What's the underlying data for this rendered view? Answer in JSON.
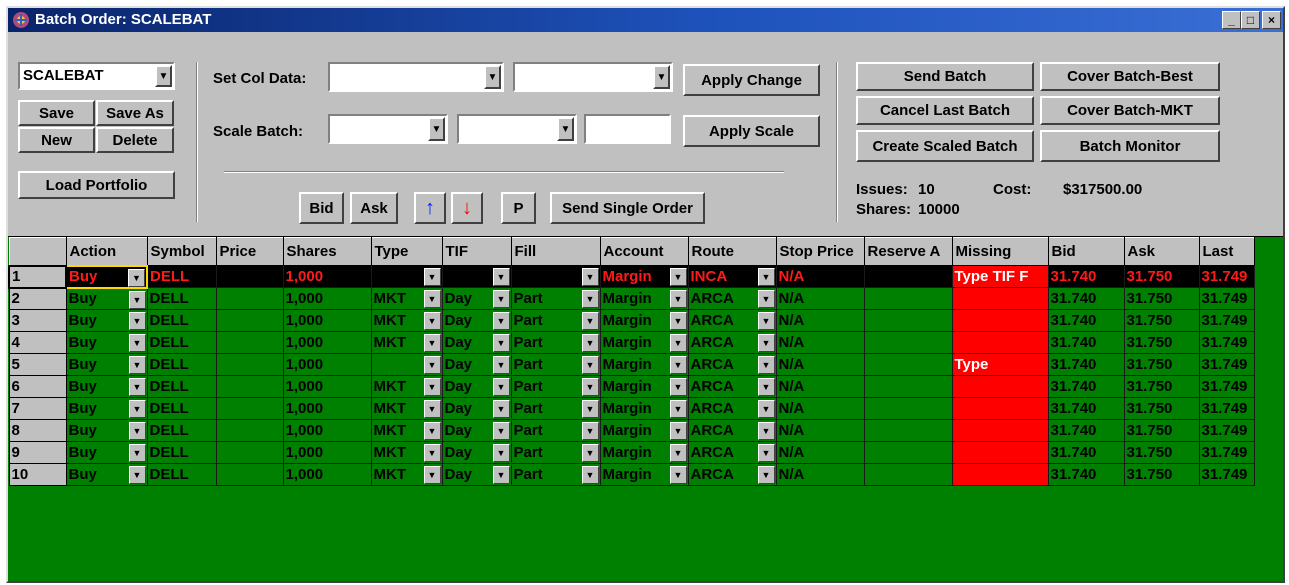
{
  "window": {
    "title": "Batch Order: SCALEBAT",
    "controls": {
      "minimize": "_",
      "maximize": "□",
      "close": "×"
    }
  },
  "batch_selector": {
    "value": "SCALEBAT"
  },
  "buttons": {
    "save": "Save",
    "save_as": "Save As",
    "new": "New",
    "delete": "Delete",
    "load_portfolio": "Load Portfolio",
    "apply_change": "Apply Change",
    "apply_scale": "Apply Scale",
    "bid": "Bid",
    "ask": "Ask",
    "up": "↑",
    "down": "↓",
    "p": "P",
    "send_single_order": "Send Single Order",
    "send_batch": "Send Batch",
    "cover_batch_best": "Cover Batch-Best",
    "cancel_last_batch": "Cancel Last Batch",
    "cover_batch_mkt": "Cover Batch-MKT",
    "create_scaled_batch": "Create Scaled Batch",
    "batch_monitor": "Batch Monitor"
  },
  "labels": {
    "set_col_data": "Set Col Data:",
    "scale_batch": "Scale Batch:"
  },
  "summary": {
    "issues_label": "Issues:",
    "issues_value": "10",
    "cost_label": "Cost:",
    "cost_value": "$317500.00",
    "shares_label": "Shares:",
    "shares_value": "10000"
  },
  "columns": [
    "",
    "Action",
    "Symbol",
    "Price",
    "Shares",
    "Type",
    "TIF",
    "Fill",
    "Account",
    "Route",
    "Stop Price",
    "Reserve A",
    "Missing",
    "Bid",
    "Ask",
    "Last"
  ],
  "rows": [
    {
      "n": "1",
      "action": "Buy",
      "symbol": "DELL",
      "price": "",
      "shares": "1,000",
      "type": "",
      "tif": "",
      "fill": "",
      "account": "Margin",
      "route": "INCA",
      "stop": "N/A",
      "reserve": "",
      "missing": "Type TIF F",
      "bid": "31.740",
      "ask": "31.750",
      "last": "31.749"
    },
    {
      "n": "2",
      "action": "Buy",
      "symbol": "DELL",
      "price": "",
      "shares": "1,000",
      "type": "MKT",
      "tif": "Day",
      "fill": "Part",
      "account": "Margin",
      "route": "ARCA",
      "stop": "N/A",
      "reserve": "",
      "missing": "",
      "bid": "31.740",
      "ask": "31.750",
      "last": "31.749"
    },
    {
      "n": "3",
      "action": "Buy",
      "symbol": "DELL",
      "price": "",
      "shares": "1,000",
      "type": "MKT",
      "tif": "Day",
      "fill": "Part",
      "account": "Margin",
      "route": "ARCA",
      "stop": "N/A",
      "reserve": "",
      "missing": "",
      "bid": "31.740",
      "ask": "31.750",
      "last": "31.749"
    },
    {
      "n": "4",
      "action": "Buy",
      "symbol": "DELL",
      "price": "",
      "shares": "1,000",
      "type": "MKT",
      "tif": "Day",
      "fill": "Part",
      "account": "Margin",
      "route": "ARCA",
      "stop": "N/A",
      "reserve": "",
      "missing": "",
      "bid": "31.740",
      "ask": "31.750",
      "last": "31.749"
    },
    {
      "n": "5",
      "action": "Buy",
      "symbol": "DELL",
      "price": "",
      "shares": "1,000",
      "type": "",
      "tif": "Day",
      "fill": "Part",
      "account": "Margin",
      "route": "ARCA",
      "stop": "N/A",
      "reserve": "",
      "missing": "Type",
      "bid": "31.740",
      "ask": "31.750",
      "last": "31.749"
    },
    {
      "n": "6",
      "action": "Buy",
      "symbol": "DELL",
      "price": "",
      "shares": "1,000",
      "type": "MKT",
      "tif": "Day",
      "fill": "Part",
      "account": "Margin",
      "route": "ARCA",
      "stop": "N/A",
      "reserve": "",
      "missing": "",
      "bid": "31.740",
      "ask": "31.750",
      "last": "31.749"
    },
    {
      "n": "7",
      "action": "Buy",
      "symbol": "DELL",
      "price": "",
      "shares": "1,000",
      "type": "MKT",
      "tif": "Day",
      "fill": "Part",
      "account": "Margin",
      "route": "ARCA",
      "stop": "N/A",
      "reserve": "",
      "missing": "",
      "bid": "31.740",
      "ask": "31.750",
      "last": "31.749"
    },
    {
      "n": "8",
      "action": "Buy",
      "symbol": "DELL",
      "price": "",
      "shares": "1,000",
      "type": "MKT",
      "tif": "Day",
      "fill": "Part",
      "account": "Margin",
      "route": "ARCA",
      "stop": "N/A",
      "reserve": "",
      "missing": "",
      "bid": "31.740",
      "ask": "31.750",
      "last": "31.749"
    },
    {
      "n": "9",
      "action": "Buy",
      "symbol": "DELL",
      "price": "",
      "shares": "1,000",
      "type": "MKT",
      "tif": "Day",
      "fill": "Part",
      "account": "Margin",
      "route": "ARCA",
      "stop": "N/A",
      "reserve": "",
      "missing": "",
      "bid": "31.740",
      "ask": "31.750",
      "last": "31.749"
    },
    {
      "n": "10",
      "action": "Buy",
      "symbol": "DELL",
      "price": "",
      "shares": "1,000",
      "type": "MKT",
      "tif": "Day",
      "fill": "Part",
      "account": "Margin",
      "route": "ARCA",
      "stop": "N/A",
      "reserve": "",
      "missing": "",
      "bid": "31.740",
      "ask": "31.750",
      "last": "31.749"
    }
  ],
  "colors": {
    "grid_bg": "#008000",
    "missing_bg": "#ff0000",
    "selected_row_text": "#ff1a1a",
    "title_blue": "#0a246a"
  }
}
